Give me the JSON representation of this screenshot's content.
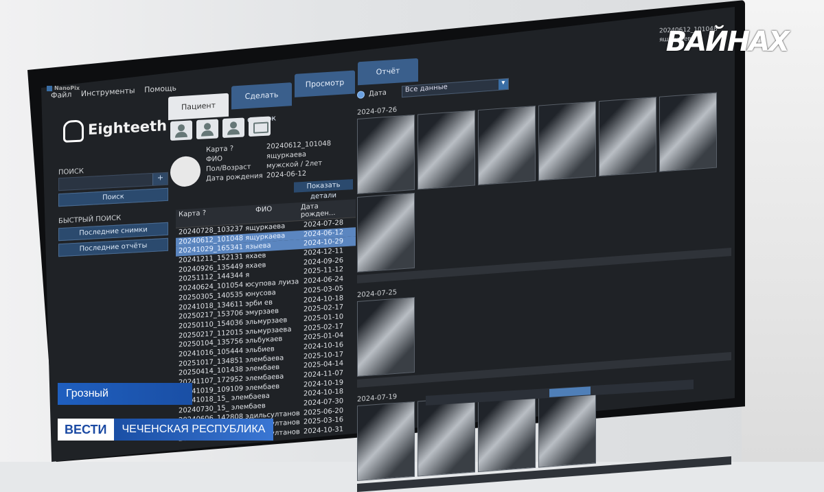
{
  "app": {
    "title": "NanoPix",
    "menu": [
      "Файл",
      "Инструменты",
      "Помощь"
    ],
    "logo": "Eighteeth"
  },
  "tabs": [
    "Пациент",
    "Сделать снимок",
    "Просмотр",
    "Отчёт"
  ],
  "left": {
    "search_label": "ПОИСК",
    "search_plus": "+",
    "search_button": "Поиск",
    "quick_label": "БЫСТРЫЙ ПОИСК",
    "recent_shots": "Последние снимки",
    "recent_reports": "Последние отчёты"
  },
  "patient": {
    "labels": [
      "Карта ?",
      "ФИО",
      "Пол/Возраст",
      "Дата рождения"
    ],
    "values": [
      "20240612_101048",
      "ящуркаева",
      "мужской / 2лет",
      "2024-06-12"
    ],
    "details_button": "Показать детали"
  },
  "table": {
    "headers": {
      "fio": "ФИО",
      "card": "Карта ?",
      "dob": "Дата рожден..."
    },
    "rows": [
      {
        "name": "20240728_103237 ящуркаева",
        "date": "2024-07-28",
        "sel": false
      },
      {
        "name": "20240612_101048 ящуркаева",
        "date": "2024-06-12",
        "sel": true
      },
      {
        "name": "20241029_165341 языева",
        "date": "2024-10-29",
        "sel": true
      },
      {
        "name": "20241211_152131 яхаев",
        "date": "2024-12-11",
        "sel": false
      },
      {
        "name": "20240926_135449 яхаев",
        "date": "2024-09-26",
        "sel": false
      },
      {
        "name": "20251112_144344 я",
        "date": "2025-11-12",
        "sel": false
      },
      {
        "name": "20240624_101054 юсупова луиза",
        "date": "2024-06-24",
        "sel": false
      },
      {
        "name": "20250305_140535 юнусова",
        "date": "2025-03-05",
        "sel": false
      },
      {
        "name": "20241018_134611 эрби ев",
        "date": "2024-10-18",
        "sel": false
      },
      {
        "name": "20250217_153706 эмурзаев",
        "date": "2025-02-17",
        "sel": false
      },
      {
        "name": "20250110_154036 эльмурзаев",
        "date": "2025-01-10",
        "sel": false
      },
      {
        "name": "20250217_112015 эльмурзаева",
        "date": "2025-02-17",
        "sel": false
      },
      {
        "name": "20250104_135756 эльбукаев",
        "date": "2025-01-04",
        "sel": false
      },
      {
        "name": "20241016_105444 эльбиев",
        "date": "2024-10-16",
        "sel": false
      },
      {
        "name": "20251017_134851 элембаева",
        "date": "2025-10-17",
        "sel": false
      },
      {
        "name": "20250414_101438 элембаев",
        "date": "2025-04-14",
        "sel": false
      },
      {
        "name": "20241107_172952 элембаева",
        "date": "2024-11-07",
        "sel": false
      },
      {
        "name": "20241019_109109 элембаев",
        "date": "2024-10-19",
        "sel": false
      },
      {
        "name": "20241018_15_ элембаева",
        "date": "2024-10-18",
        "sel": false
      },
      {
        "name": "20240730_15_ элембаев",
        "date": "2024-07-30",
        "sel": false
      },
      {
        "name": "20240606_142808 эдильсултанов",
        "date": "2025-06-20",
        "sel": false
      },
      {
        "name": "20250316_147568 эдильсултанов",
        "date": "2025-03-16",
        "sel": false
      },
      {
        "name": "20241031_150201 эдильсултанов",
        "date": "2024-10-31",
        "sel": false
      }
    ]
  },
  "viewer": {
    "filter_label": "Дата",
    "filter_value": "Все данные",
    "groups": [
      {
        "date": "2024-07-26",
        "count": 7
      },
      {
        "date": "2024-07-25",
        "count": 1
      },
      {
        "date": "2024-07-19",
        "count": 4
      }
    ]
  },
  "overlay": {
    "channel_logo": "ВАЙНАХ",
    "city": "Грозный",
    "brand": "ВЕСТИ",
    "region": "ЧЕЧЕНСКАЯ РЕСПУБЛИКА",
    "corner_lines": [
      "20240612_101048",
      "ящуркаева"
    ]
  },
  "colors": {
    "accent": "#3a6ea5",
    "selection": "#5b86c0",
    "screen_bg": "#1f2226",
    "caption_blue": "#1a4fa5"
  }
}
